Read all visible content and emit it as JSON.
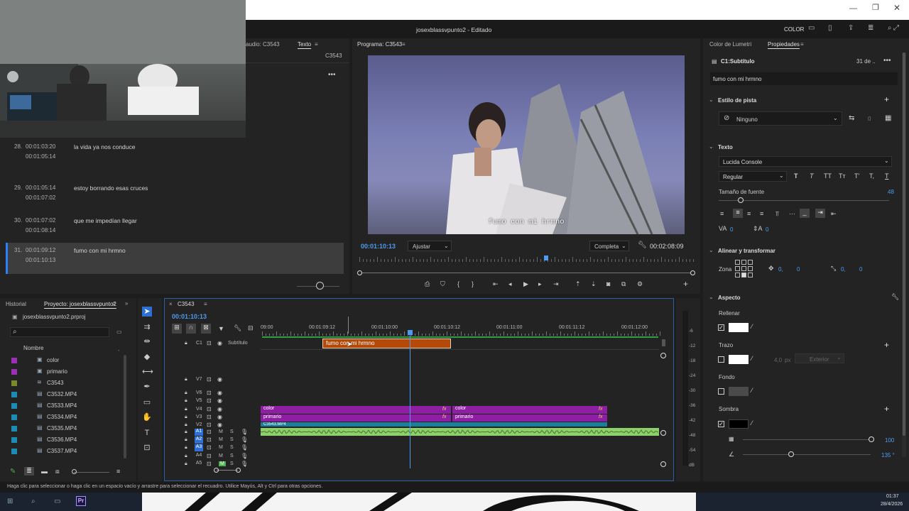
{
  "titlebar": {
    "project_title": "josexblassvpunto2 - Editado",
    "workspace": "COLOR"
  },
  "left_top": {
    "tab_audio": "audio: C3543",
    "tab_text": "Texto",
    "sequence_label": "C3543"
  },
  "subtitles": [
    {
      "idx": "28.",
      "in": "00:01:03:20",
      "out": "00:01:05:14",
      "text": "la vida ya nos conduce"
    },
    {
      "idx": "29.",
      "in": "00:01:05:14",
      "out": "00:01:07:02",
      "text": "estoy borrando esas cruces"
    },
    {
      "idx": "30.",
      "in": "00:01:07:02",
      "out": "00:01:08:14",
      "text": "que me impedían llegar"
    },
    {
      "idx": "31.",
      "in": "00:01:09:12",
      "out": "00:01:10:13",
      "text": "fumo con mi hrmno"
    }
  ],
  "program": {
    "tab": "Programa: C3543",
    "caption": "fumo con mi hrmno",
    "timecode": "00:01:10:13",
    "fit": "Ajustar",
    "quality": "Completa",
    "duration": "00:02:08:09",
    "playhead_fraction": 0.56
  },
  "project": {
    "tab_history": "Historial",
    "tab_project": "Proyecto: josexblassvpunto2",
    "file": "josexblassvpunto2.prproj",
    "col_name": "Nombre",
    "items": [
      {
        "name": "color",
        "color": "#9b2fb5",
        "icon": "adjustment-icon"
      },
      {
        "name": "primario",
        "color": "#9b2fb5",
        "icon": "adjustment-icon"
      },
      {
        "name": "C3543",
        "color": "#7a8a2a",
        "icon": "sequence-icon"
      },
      {
        "name": "C3532.MP4",
        "color": "#1e8bb5",
        "icon": "clip-icon"
      },
      {
        "name": "C3533.MP4",
        "color": "#1e8bb5",
        "icon": "clip-icon"
      },
      {
        "name": "C3534.MP4",
        "color": "#1e8bb5",
        "icon": "clip-icon"
      },
      {
        "name": "C3535.MP4",
        "color": "#1e8bb5",
        "icon": "clip-icon"
      },
      {
        "name": "C3536.MP4",
        "color": "#1e8bb5",
        "icon": "clip-icon"
      },
      {
        "name": "C3537.MP4",
        "color": "#1e8bb5",
        "icon": "clip-icon"
      }
    ]
  },
  "timeline": {
    "tab": "C3543",
    "timecode": "00:01:10:13",
    "ruler": [
      "09:00",
      "00:01:09:12",
      "00:01:10:00",
      "00:01:10:12",
      "00:01:11:00",
      "00:01:11:12",
      "00:01:12:00"
    ],
    "subtitle_track": "Subtítulo",
    "subtitle_clip": "fumo con mi hrmno",
    "tracks_video": [
      "V7",
      "V6",
      "V5",
      "V4",
      "V3",
      "V2"
    ],
    "tracks_audio": [
      "A1",
      "A2",
      "A3",
      "A4",
      "A5"
    ],
    "c1": "C1",
    "clip_color1": "color",
    "clip_primario1": "primario",
    "clip_color2": "color",
    "clip_primario2": "primario",
    "clip_c": "C3543.MP4",
    "fx": "fx",
    "db_scale": [
      "-6",
      "-12",
      "-18",
      "-24",
      "-30",
      "-36",
      "-42",
      "-48",
      "-54",
      "dB"
    ],
    "m": "M",
    "s": "S"
  },
  "properties": {
    "tab_lumetri": "Color de Lumetri",
    "tab_props": "Propiedades",
    "clip_name": "C1:Subtítulo",
    "clip_date": "31 de ..",
    "text_value": "fumo con mi hrmno",
    "track_style_heading": "Estilo de pista",
    "track_style_value": "Ninguno",
    "track_style_count": "0",
    "text_heading": "Texto",
    "font": "Lucida Console",
    "font_style": "Regular",
    "size_label": "Tamaño de fuente",
    "size_value": "48",
    "tracking": "0",
    "leading": "0",
    "align_heading": "Alinear y transformar",
    "zone_label": "Zona",
    "pos_x": "0,",
    "pos_y": "0",
    "scale_x": "0,",
    "scale_y": "0",
    "appearance_heading": "Aspecto",
    "fill_label": "Rellenar",
    "stroke_label": "Trazo",
    "stroke_width": "4,0",
    "stroke_unit": "px",
    "stroke_type": "Exterior",
    "background_label": "Fondo",
    "shadow_label": "Sombra",
    "shadow_opacity": "100",
    "shadow_angle": "135 °"
  },
  "status": {
    "hint": "Haga clic para seleccionar o haga clic en un espacio vacío y arrastre para seleccionar el recuadro. Utilice Mayús, Alt y Ctrl para otras opciones."
  },
  "taskbar": {
    "time": "01:37",
    "date": "28/4/2026",
    "app": "Pr"
  }
}
